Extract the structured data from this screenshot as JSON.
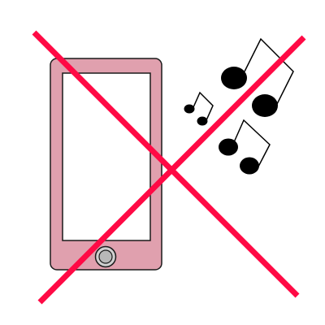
{
  "illustration": {
    "subject": "smartphone-with-music-notes",
    "prohibition_mark": "red-cross",
    "colors": {
      "phone_body": "#e0a0ae",
      "phone_outline": "#1a1a1a",
      "screen": "#ffffff",
      "home_button_outer": "#d0d0d0",
      "home_button_inner": "#b8b8b8",
      "notes": "#000000",
      "cross": "#ff0a45",
      "background": "#ffffff"
    },
    "icons": [
      "smartphone-icon",
      "music-notes-icon",
      "prohibition-cross-icon"
    ]
  }
}
